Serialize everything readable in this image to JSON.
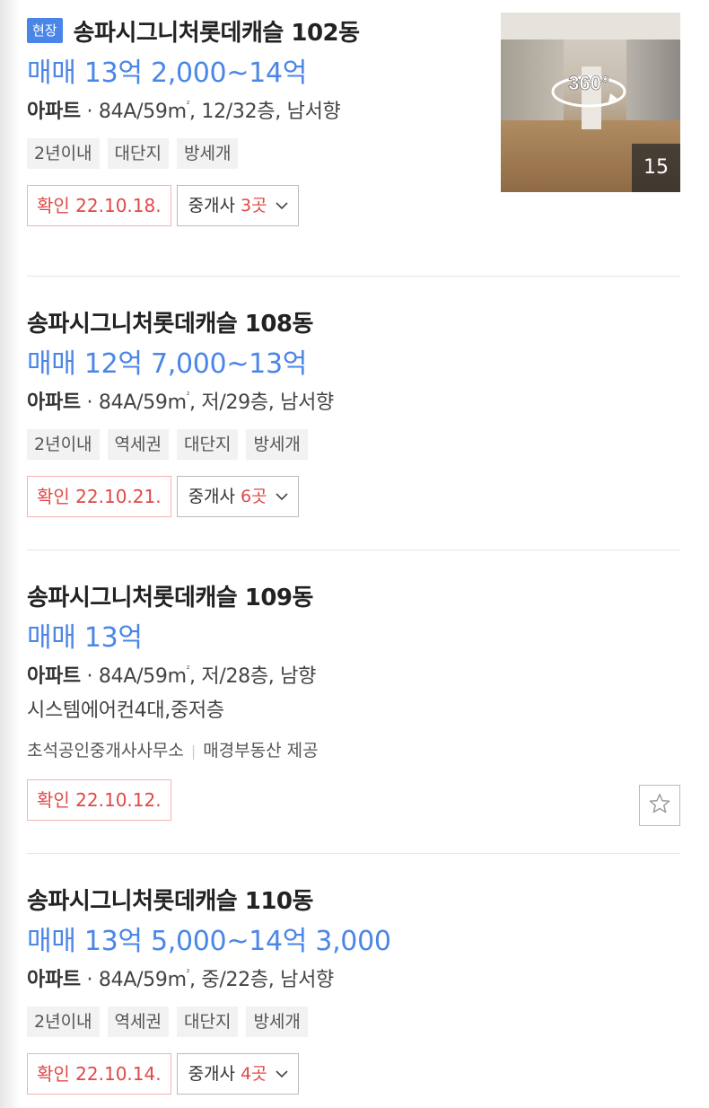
{
  "colors": {
    "accent": "#4a86e8",
    "confirm_red": "#e04848",
    "tag_bg": "#f2f2f2"
  },
  "listings": [
    {
      "badge": "현장",
      "title": "송파시그니처롯데캐슬 102동",
      "price": "매매 13억 2,000~14억",
      "type": "아파트",
      "area": "84A/59m",
      "area_sup": "²",
      "floor_dir": ", 12/32층, 남서향",
      "tags": [
        "2년이내",
        "대단지",
        "방세개"
      ],
      "confirm": "확인 22.10.18.",
      "brokers_label": "중개사",
      "brokers_count": "3곳",
      "photo_count": "15",
      "pano_label": "360°"
    },
    {
      "title": "송파시그니처롯데캐슬 108동",
      "price": "매매 12억 7,000~13억",
      "type": "아파트",
      "area": "84A/59m",
      "area_sup": "²",
      "floor_dir": ", 저/29층, 남서향",
      "tags": [
        "2년이내",
        "역세권",
        "대단지",
        "방세개"
      ],
      "confirm": "확인 22.10.21.",
      "brokers_label": "중개사",
      "brokers_count": "6곳"
    },
    {
      "title": "송파시그니처롯데캐슬 109동",
      "price": "매매 13억",
      "type": "아파트",
      "area": "84A/59m",
      "area_sup": "²",
      "floor_dir": ", 저/28층, 남향",
      "description": "시스템에어컨4대,중저층",
      "agency": "초석공인중개사사무소",
      "provider": "매경부동산 제공",
      "confirm": "확인 22.10.12."
    },
    {
      "title": "송파시그니처롯데캐슬 110동",
      "price": "매매 13억 5,000~14억 3,000",
      "type": "아파트",
      "area": "84A/59m",
      "area_sup": "²",
      "floor_dir": ", 중/22층, 남서향",
      "tags": [
        "2년이내",
        "역세권",
        "대단지",
        "방세개"
      ],
      "confirm": "확인 22.10.14.",
      "brokers_label": "중개사",
      "brokers_count": "4곳"
    }
  ],
  "icons": {
    "chevron": "chevron-down-icon",
    "star": "star-outline-icon",
    "pano": "360-view-icon"
  }
}
